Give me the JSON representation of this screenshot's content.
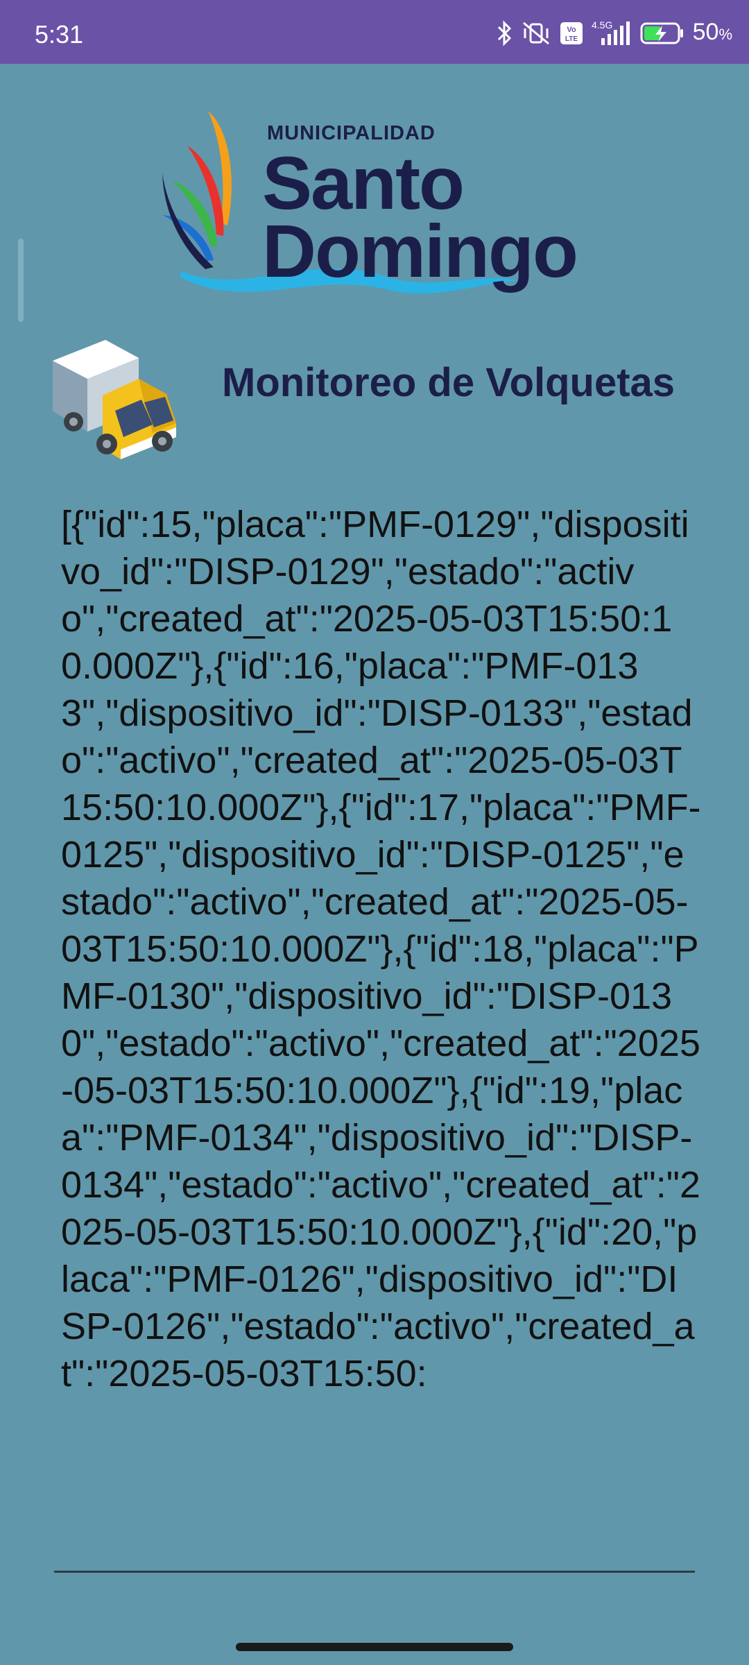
{
  "status_bar": {
    "time": "5:31",
    "network_label": "4.5G",
    "volte_label": "Vo LTE",
    "battery_percent": "50",
    "battery_unit": "%",
    "icons": [
      "bluetooth-icon",
      "vibrate-off-icon",
      "volte-icon",
      "signal-icon",
      "battery-charging-icon"
    ]
  },
  "logo": {
    "top_text": "MUNICIPALIDAD",
    "line1": "Santo",
    "line2": "Domingo",
    "colors": {
      "navy": "#1c1e4a",
      "orange": "#f5a01a",
      "red": "#e8322b",
      "green": "#3cb54a",
      "blue": "#1d6fd1",
      "wave": "#2bb3e6"
    }
  },
  "header": {
    "title": "Monitoreo de Volquetas",
    "icon": "truck-icon"
  },
  "response_text": "[{\"id\":15,\"placa\":\"PMF-0129\",\"dispositivo_id\":\"DISP-0129\",\"estado\":\"activo\",\"created_at\":\"2025-05-03T15:50:10.000Z\"},{\"id\":16,\"placa\":\"PMF-0133\",\"dispositivo_id\":\"DISP-0133\",\"estado\":\"activo\",\"created_at\":\"2025-05-03T15:50:10.000Z\"},{\"id\":17,\"placa\":\"PMF-0125\",\"dispositivo_id\":\"DISP-0125\",\"estado\":\"activo\",\"created_at\":\"2025-05-03T15:50:10.000Z\"},{\"id\":18,\"placa\":\"PMF-0130\",\"dispositivo_id\":\"DISP-0130\",\"estado\":\"activo\",\"created_at\":\"2025-05-03T15:50:10.000Z\"},{\"id\":19,\"placa\":\"PMF-0134\",\"dispositivo_id\":\"DISP-0134\",\"estado\":\"activo\",\"created_at\":\"2025-05-03T15:50:10.000Z\"},{\"id\":20,\"placa\":\"PMF-0126\",\"dispositivo_id\":\"DISP-0126\",\"estado\":\"activo\",\"created_at\":\"2025-05-03T15:50:",
  "colors": {
    "status_bar": "#6a52a6",
    "background": "#6197aa",
    "title": "#1c1e4a"
  }
}
